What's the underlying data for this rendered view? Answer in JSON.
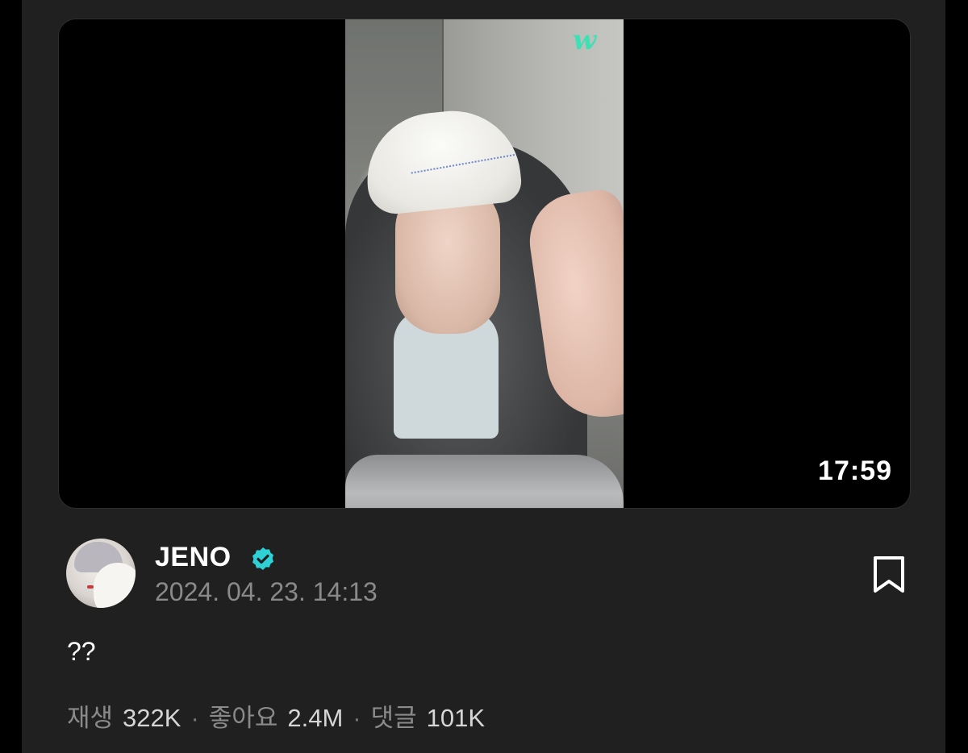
{
  "video": {
    "duration": "17:59",
    "watermark": "w"
  },
  "post": {
    "author": "JENO",
    "verified": true,
    "date": "2024. 04. 23. 14:13",
    "caption": "??"
  },
  "stats": {
    "plays_label": "재생",
    "plays_value": "322K",
    "likes_label": "좋아요",
    "likes_value": "2.4M",
    "comments_label": "댓글",
    "comments_value": "101K",
    "separator": "·"
  },
  "colors": {
    "background": "#202020",
    "accent": "#2ed1d6",
    "watermark": "#3fe0b4",
    "text_primary": "#ffffff",
    "text_secondary": "#8a8a8a"
  },
  "icons": {
    "verified": "verified-badge-icon",
    "bookmark": "bookmark-icon"
  }
}
